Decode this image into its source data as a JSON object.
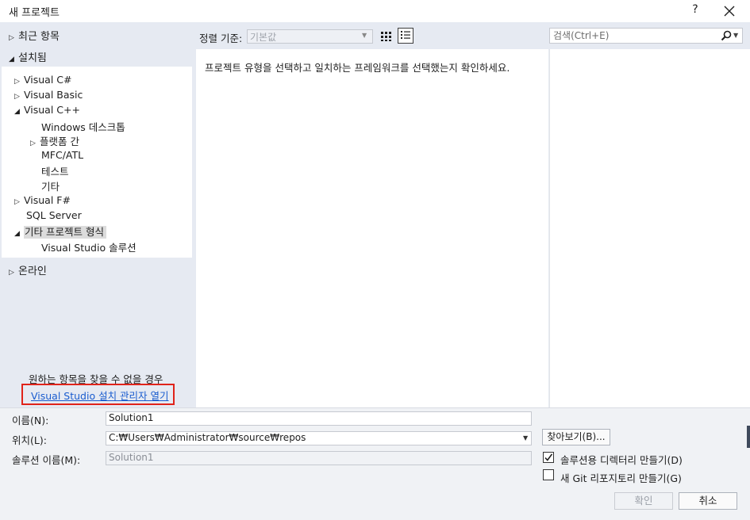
{
  "window": {
    "title": "새 프로젝트",
    "help": "?",
    "close_icon": "close-icon"
  },
  "left": {
    "recent": "최근 항목",
    "installed": "설치됨",
    "online": "온라인",
    "tree": {
      "visual_csharp": "Visual C#",
      "visual_basic": "Visual Basic",
      "visual_cpp": "Visual C++",
      "windows_desktop": "Windows 데스크톱",
      "cross_platform": "플랫폼 간",
      "mfc_atl": "MFC/ATL",
      "test": "테스트",
      "other": "기타",
      "visual_fsharp": "Visual F#",
      "sql_server": "SQL Server",
      "other_project_types": "기타 프로젝트 형식",
      "vs_solution": "Visual Studio 솔루션"
    },
    "not_found_text": "원하는 항목을 찾을 수 없을 경우",
    "installer_link": "Visual Studio 설치 관리자 열기"
  },
  "center": {
    "sort_label": "정렬 기준:",
    "sort_value": "기본값",
    "message": "프로젝트 유형을 선택하고 일치하는 프레임워크를 선택했는지 확인하세요."
  },
  "search": {
    "placeholder": "검색(Ctrl+E)"
  },
  "form": {
    "name_label": "이름(N):",
    "name_value": "Solution1",
    "location_label": "위치(L):",
    "location_value": "C:₩Users₩Administrator₩source₩repos",
    "solution_name_label": "솔루션 이름(M):",
    "solution_name_value": "Solution1",
    "browse_label": "찾아보기(B)...",
    "create_dir_label": "솔루션용 디렉터리 만들기(D)",
    "create_dir_checked": true,
    "git_repo_label": "새 Git 리포지토리 만들기(G)",
    "git_repo_checked": false,
    "ok_label": "확인",
    "cancel_label": "취소"
  },
  "colors": {
    "accent_link": "#1a5ccf",
    "highlight_box": "#e0231a",
    "panel_bg": "#e6eaf2"
  }
}
